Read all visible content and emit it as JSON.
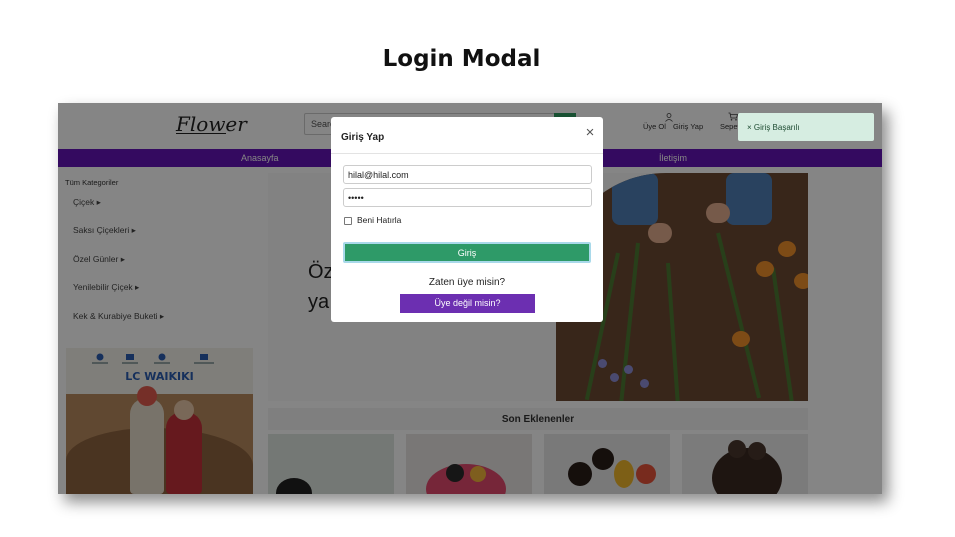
{
  "slide": {
    "title": "Login Modal"
  },
  "header": {
    "logo": "Flower",
    "search_placeholder": "Search",
    "links": {
      "register": "Üye Ol",
      "login": "Giriş Yap",
      "cart": "Sepet"
    }
  },
  "nav": {
    "items": [
      "Anasayfa",
      "İletişim"
    ]
  },
  "sidebar": {
    "title": "Tüm Kategoriler",
    "categories": [
      "Çiçek ▸",
      "Saksı Çiçekleri ▸",
      "Özel Günler ▸",
      "Yenilebilir Çiçek ▸",
      "Kek & Kurabiye Buketi ▸"
    ],
    "ad_brand": "LC WAIKIKI"
  },
  "hero": {
    "line1": "Öz",
    "line2": "ya"
  },
  "section": {
    "title": "Son Eklenenler"
  },
  "modal": {
    "title": "Giriş Yap",
    "close": "×",
    "email_value": "hilal@hilal.com",
    "password_value": "•••••",
    "remember_label": "Beni Hatırla",
    "login_button": "Giriş",
    "already_member": "Zaten üye misin?",
    "register_button": "Üye değil misin?"
  },
  "toast": {
    "message": "× Giriş Başarılı"
  },
  "colors": {
    "nav": "#6414b8",
    "login_button": "#2e9a68",
    "register_button": "#6c2fb1",
    "toast_bg": "#d6ede1"
  }
}
